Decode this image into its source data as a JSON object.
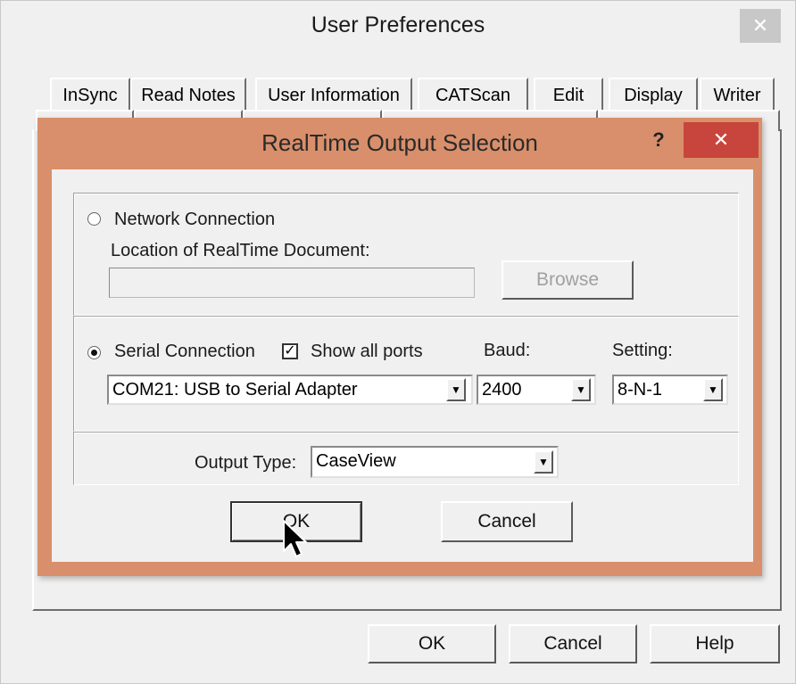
{
  "outer_window": {
    "title": "User Preferences",
    "close_glyph": "✕",
    "tabs": [
      "InSync",
      "Read Notes",
      "User Information",
      "CATScan",
      "Edit",
      "Display",
      "Writer"
    ],
    "buttons": {
      "ok": "OK",
      "cancel": "Cancel",
      "help": "Help"
    }
  },
  "dialog": {
    "title": "RealTime Output Selection",
    "help_glyph": "?",
    "close_glyph": "✕",
    "network": {
      "radio_label": "Network Connection",
      "location_label": "Location of RealTime Document:",
      "location_value": "",
      "browse_label": "Browse"
    },
    "serial": {
      "radio_label": "Serial Connection",
      "show_all_ports_label": "Show all ports",
      "show_all_ports_checked": true,
      "port_value": "COM21: USB to Serial Adapter",
      "baud_label": "Baud:",
      "baud_value": "2400",
      "setting_label": "Setting:",
      "setting_value": "8-N-1"
    },
    "output": {
      "label": "Output Type:",
      "value": "CaseView"
    },
    "buttons": {
      "ok": "OK",
      "cancel": "Cancel"
    },
    "selected_connection": "serial"
  },
  "colors": {
    "dialog_frame": "#d98f6b",
    "close_button": "#c7453c",
    "window_bg": "#f0f0f0"
  }
}
